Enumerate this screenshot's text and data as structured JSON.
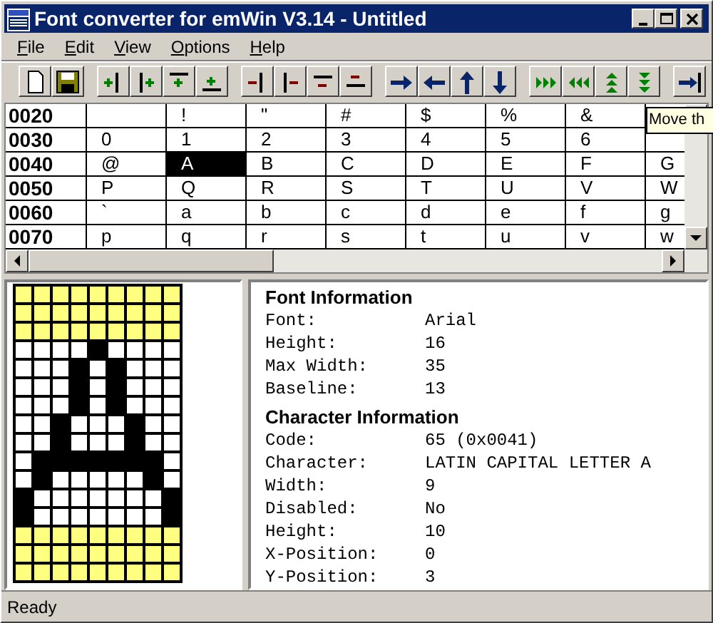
{
  "window": {
    "title": "Font converter for emWin V3.14 - Untitled"
  },
  "menu": [
    "File",
    "Edit",
    "View",
    "Options",
    "Help"
  ],
  "table": {
    "rows": [
      {
        "code": "0020",
        "cells": [
          {
            "selected": false
          },
          {
            "char": "!",
            "selected": false
          },
          {
            "char": "\"",
            "selected": false
          },
          {
            "char": "#",
            "selected": false
          },
          {
            "char": "$",
            "selected": false
          },
          {
            "char": "%",
            "selected": false
          },
          {
            "char": "&",
            "selected": false
          }
        ]
      },
      {
        "code": "0030",
        "cells": [
          {
            "char": "0",
            "selected": false
          },
          {
            "char": "1",
            "selected": false
          },
          {
            "char": "2",
            "selected": false
          },
          {
            "char": "3",
            "selected": false
          },
          {
            "char": "4",
            "selected": false
          },
          {
            "char": "5",
            "selected": false
          },
          {
            "char": "6",
            "selected": false
          },
          {
            "selected": false
          }
        ]
      },
      {
        "code": "0040",
        "cells": [
          {
            "char": "@",
            "selected": false
          },
          {
            "char": "A",
            "selected": true
          },
          {
            "char": "B",
            "selected": false
          },
          {
            "char": "C",
            "selected": false
          },
          {
            "char": "D",
            "selected": false
          },
          {
            "char": "E",
            "selected": false
          },
          {
            "char": "F",
            "selected": false
          },
          {
            "char": "G",
            "selected": false
          }
        ]
      },
      {
        "code": "0050",
        "cells": [
          {
            "char": "P",
            "selected": false
          },
          {
            "char": "Q",
            "selected": false
          },
          {
            "char": "R",
            "selected": false
          },
          {
            "char": "S",
            "selected": false
          },
          {
            "char": "T",
            "selected": false
          },
          {
            "char": "U",
            "selected": false
          },
          {
            "char": "V",
            "selected": false
          },
          {
            "char": "W",
            "selected": false
          }
        ]
      },
      {
        "code": "0060",
        "cells": [
          {
            "char": "`",
            "selected": false
          },
          {
            "char": "a",
            "selected": false
          },
          {
            "char": "b",
            "selected": false
          },
          {
            "char": "c",
            "selected": false
          },
          {
            "char": "d",
            "selected": false
          },
          {
            "char": "e",
            "selected": false
          },
          {
            "char": "f",
            "selected": false
          },
          {
            "char": "g",
            "selected": false
          }
        ]
      },
      {
        "code": "0070",
        "cells": [
          {
            "char": "p",
            "selected": false
          },
          {
            "char": "q",
            "selected": false
          },
          {
            "char": "r",
            "selected": false
          },
          {
            "char": "s",
            "selected": false
          },
          {
            "char": "t",
            "selected": false
          },
          {
            "char": "u",
            "selected": false
          },
          {
            "char": "v",
            "selected": false
          },
          {
            "char": "w",
            "selected": false
          }
        ]
      }
    ]
  },
  "tooltip": "Move th",
  "glyph": {
    "rows": [
      {
        "in_glyph": false,
        "pixels": [
          false,
          false,
          false,
          false,
          false,
          false,
          false,
          false,
          false
        ]
      },
      {
        "in_glyph": false,
        "pixels": [
          false,
          false,
          false,
          false,
          false,
          false,
          false,
          false,
          false
        ]
      },
      {
        "in_glyph": false,
        "pixels": [
          false,
          false,
          false,
          false,
          false,
          false,
          false,
          false,
          false
        ]
      },
      {
        "in_glyph": true,
        "pixels": [
          false,
          false,
          false,
          false,
          true,
          false,
          false,
          false,
          false
        ]
      },
      {
        "in_glyph": true,
        "pixels": [
          false,
          false,
          false,
          true,
          false,
          true,
          false,
          false,
          false
        ]
      },
      {
        "in_glyph": true,
        "pixels": [
          false,
          false,
          false,
          true,
          false,
          true,
          false,
          false,
          false
        ]
      },
      {
        "in_glyph": true,
        "pixels": [
          false,
          false,
          false,
          true,
          false,
          true,
          false,
          false,
          false
        ]
      },
      {
        "in_glyph": true,
        "pixels": [
          false,
          false,
          true,
          false,
          false,
          false,
          true,
          false,
          false
        ]
      },
      {
        "in_glyph": true,
        "pixels": [
          false,
          false,
          true,
          false,
          false,
          false,
          true,
          false,
          false
        ]
      },
      {
        "in_glyph": true,
        "pixels": [
          false,
          true,
          true,
          true,
          true,
          true,
          true,
          true,
          false
        ]
      },
      {
        "in_glyph": true,
        "pixels": [
          false,
          true,
          false,
          false,
          false,
          false,
          false,
          true,
          false
        ]
      },
      {
        "in_glyph": true,
        "pixels": [
          true,
          false,
          false,
          false,
          false,
          false,
          false,
          false,
          true
        ]
      },
      {
        "in_glyph": true,
        "pixels": [
          true,
          false,
          false,
          false,
          false,
          false,
          false,
          false,
          true
        ]
      },
      {
        "in_glyph": false,
        "pixels": [
          false,
          false,
          false,
          false,
          false,
          false,
          false,
          false,
          false
        ]
      },
      {
        "in_glyph": false,
        "pixels": [
          false,
          false,
          false,
          false,
          false,
          false,
          false,
          false,
          false
        ]
      },
      {
        "in_glyph": false,
        "pixels": [
          false,
          false,
          false,
          false,
          false,
          false,
          false,
          false,
          false
        ]
      }
    ]
  },
  "info": [
    {
      "heading": "Font Information",
      "fields": [
        {
          "label": "Font:",
          "value": "Arial"
        },
        {
          "label": "Height:",
          "value": "16"
        },
        {
          "label": "Max Width:",
          "value": "35"
        },
        {
          "label": "Baseline:",
          "value": "13"
        }
      ]
    },
    {
      "heading": "Character Information",
      "fields": [
        {
          "label": "Code:",
          "value": "65 (0x0041)"
        },
        {
          "label": "Character:",
          "value": "LATIN CAPITAL LETTER A"
        },
        {
          "label": "Width:",
          "value": "9"
        },
        {
          "label": "Disabled:",
          "value": "No"
        },
        {
          "label": "Height:",
          "value": "10"
        },
        {
          "label": "X-Position:",
          "value": "0"
        },
        {
          "label": "Y-Position:",
          "value": "3"
        }
      ]
    }
  ],
  "status_bar": "Ready"
}
